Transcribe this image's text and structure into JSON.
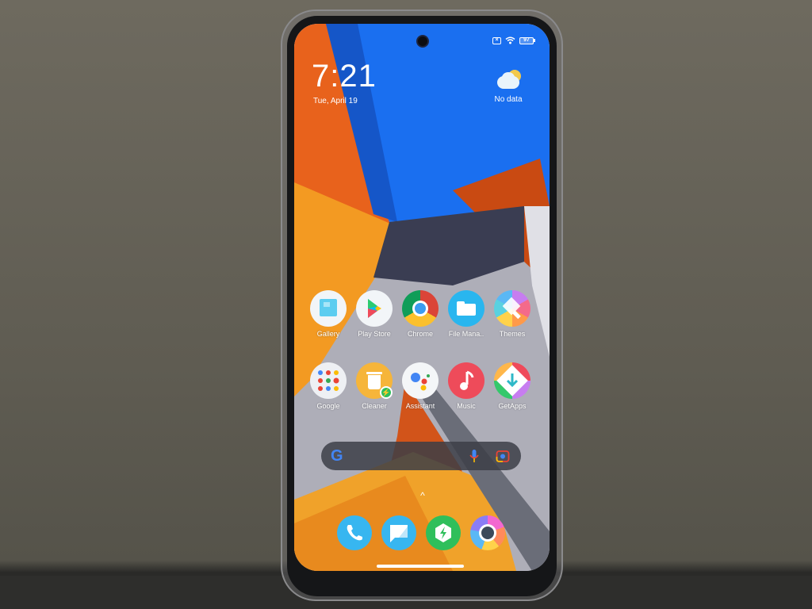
{
  "status_bar": {
    "sim_icon": "sim-card-x-icon",
    "wifi_icon": "wifi-icon",
    "battery_level": "97"
  },
  "clock": {
    "time": "7:21",
    "date": "Tue, April 19"
  },
  "weather": {
    "icon": "partly-cloudy-icon",
    "label": "No data"
  },
  "apps_row1": [
    {
      "label": "Gallery",
      "icon": "gallery-icon"
    },
    {
      "label": "Play Store",
      "icon": "play-store-icon"
    },
    {
      "label": "Chrome",
      "icon": "chrome-icon"
    },
    {
      "label": "File Mana..",
      "icon": "folder-icon"
    },
    {
      "label": "Themes",
      "icon": "themes-brush-icon"
    }
  ],
  "apps_row2": [
    {
      "label": "Google",
      "icon": "google-folder-icon"
    },
    {
      "label": "Cleaner",
      "icon": "trash-bin-icon"
    },
    {
      "label": "Assistant",
      "icon": "assistant-dots-icon"
    },
    {
      "label": "Music",
      "icon": "music-note-icon"
    },
    {
      "label": "GetApps",
      "icon": "download-arrow-icon"
    }
  ],
  "search_bar": {
    "logo": "G",
    "mic_icon": "microphone-icon",
    "lens_icon": "google-lens-icon"
  },
  "app_drawer_arrow": "^",
  "dock": [
    {
      "name": "Phone",
      "icon": "phone-icon"
    },
    {
      "name": "Messaging",
      "icon": "message-icon"
    },
    {
      "name": "Security",
      "icon": "security-bolt-icon"
    },
    {
      "name": "Camera",
      "icon": "camera-icon"
    }
  ],
  "colors": {
    "wallpaper_blue": "#1a6ff0",
    "wallpaper_orange": "#e8621c",
    "wallpaper_yellow": "#f0a22a",
    "wallpaper_gray": "#a9a9b3",
    "dock_blue": "#37b6f0",
    "security_green": "#2fbf5b"
  }
}
